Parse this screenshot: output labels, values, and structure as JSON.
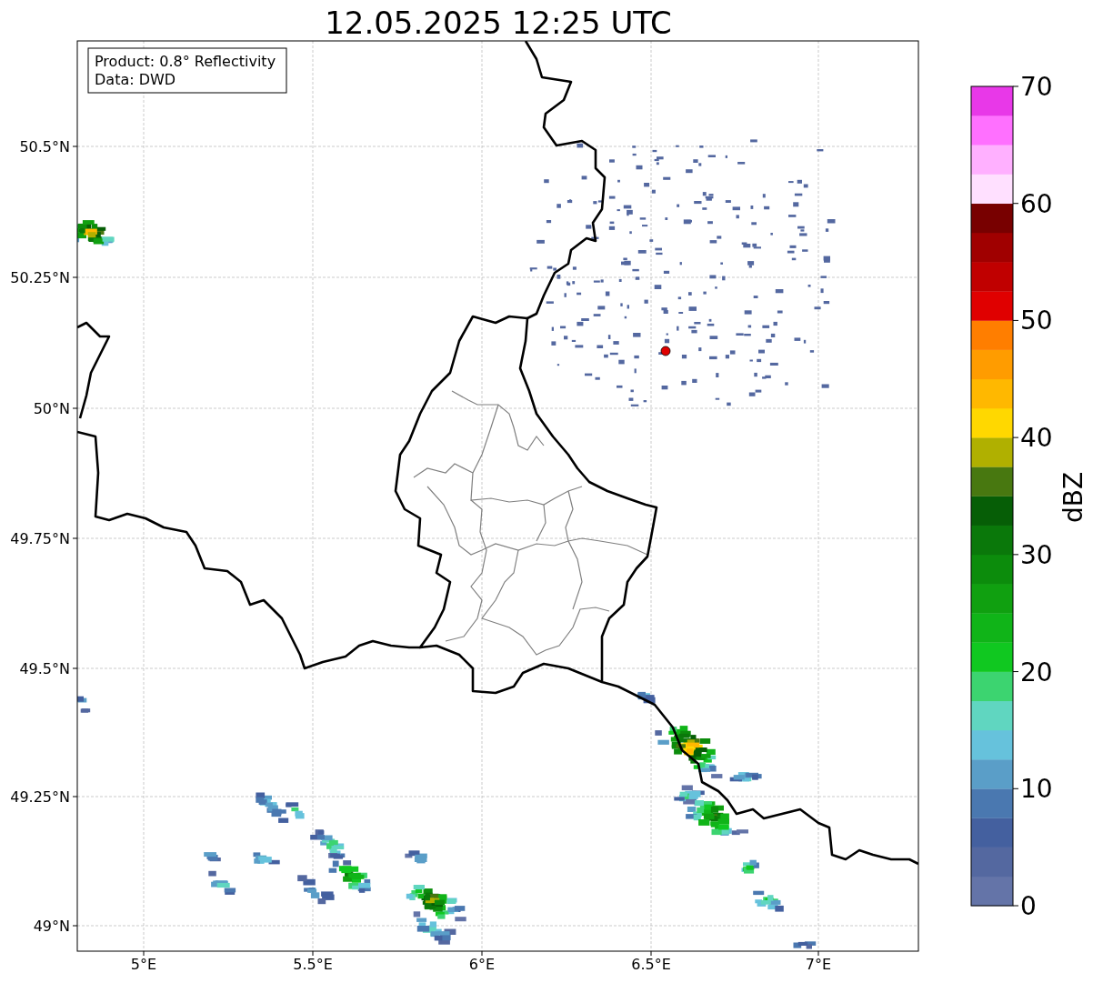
{
  "title": "12.05.2025 12:25 UTC",
  "info_box": [
    "Product: 0.8° Reflectivity",
    "Data: DWD"
  ],
  "x_ticks": [
    "5°E",
    "5.5°E",
    "6°E",
    "6.5°E",
    "7°E"
  ],
  "y_ticks": [
    "50.5°N",
    "50.25°N",
    "50°N",
    "49.75°N",
    "49.5°N",
    "49.25°N",
    "49°N"
  ],
  "colorbar": {
    "label": "dBZ",
    "ticks": [
      "70",
      "60",
      "50",
      "40",
      "30",
      "20",
      "10",
      "0"
    ],
    "segments": [
      {
        "color": "#6474a8"
      },
      {
        "color": "#5468a0"
      },
      {
        "color": "#44609f"
      },
      {
        "color": "#4a78b0"
      },
      {
        "color": "#5a9ec8"
      },
      {
        "color": "#66c2dc"
      },
      {
        "color": "#60d6c0"
      },
      {
        "color": "#3cd470"
      },
      {
        "color": "#10c820"
      },
      {
        "color": "#10b418"
      },
      {
        "color": "#10a010"
      },
      {
        "color": "#0c8c0c"
      },
      {
        "color": "#0a780a"
      },
      {
        "color": "#065e06"
      },
      {
        "color": "#487810"
      },
      {
        "color": "#b0b000"
      },
      {
        "color": "#ffd800"
      },
      {
        "color": "#ffb800"
      },
      {
        "color": "#ff9c00"
      },
      {
        "color": "#ff7e00"
      },
      {
        "color": "#e00000"
      },
      {
        "color": "#c00000"
      },
      {
        "color": "#a00000"
      },
      {
        "color": "#780000"
      },
      {
        "color": "#ffe0ff"
      },
      {
        "color": "#ffb0ff"
      },
      {
        "color": "#ff70ff"
      },
      {
        "color": "#e838e8"
      }
    ]
  }
}
